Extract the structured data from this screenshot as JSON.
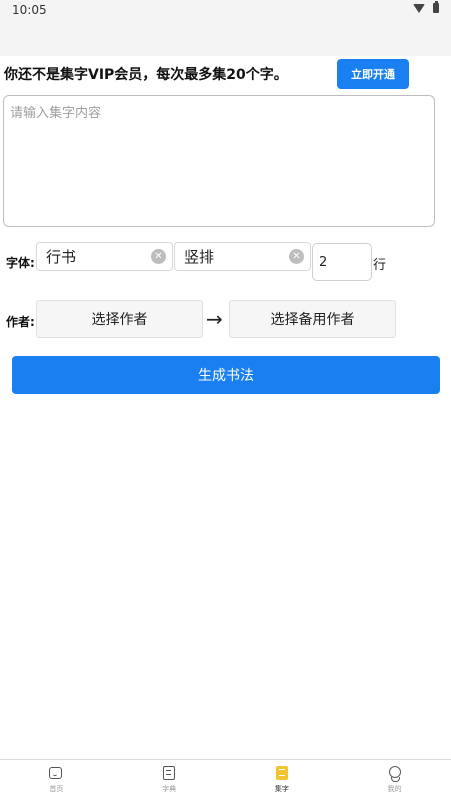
{
  "status_bar": {
    "time": "10:05",
    "wifi_icon": "wifi-icon",
    "battery_icon": "battery-icon"
  },
  "vip_banner": {
    "text": "你还不是集字VIP会员，每次最多集20个字。",
    "button_label": "立即开通"
  },
  "content_input": {
    "placeholder": "请输入集字内容",
    "value": ""
  },
  "font_row": {
    "label": "字体:",
    "style_value": "行书",
    "layout_value": "竖排",
    "lines_value": "2",
    "lines_unit": "行"
  },
  "author_row": {
    "label": "作者:",
    "select_author_label": "选择作者",
    "arrow": "→",
    "select_backup_label": "选择备用作者"
  },
  "generate_button_label": "生成书法",
  "bottom_nav": {
    "items": [
      {
        "label": "首页",
        "icon": "home-icon",
        "active": false
      },
      {
        "label": "字典",
        "icon": "dictionary-icon",
        "active": false
      },
      {
        "label": "集字",
        "icon": "collect-icon",
        "active": true
      },
      {
        "label": "我的",
        "icon": "profile-icon",
        "active": false
      }
    ]
  },
  "colors": {
    "accent": "#1a7ff0",
    "active_tab": "#f4c430"
  }
}
